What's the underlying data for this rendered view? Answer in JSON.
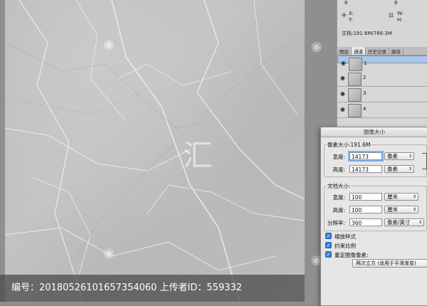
{
  "info_panel": {
    "row1_left": "8",
    "row1_right": "8",
    "x_label": "X:",
    "y_label": "Y:",
    "w_label": "W:",
    "h_label": "H:",
    "doc_size": "文档:191.6M/766.3M"
  },
  "layers_panel": {
    "tabs": [
      "图层",
      "通道",
      "历史记录",
      "路径"
    ],
    "active_tab": "通道",
    "channels": [
      {
        "label": "1",
        "selected": true
      },
      {
        "label": "2",
        "selected": false
      },
      {
        "label": "3",
        "selected": false
      },
      {
        "label": "4",
        "selected": false
      }
    ]
  },
  "dialog": {
    "title": "图像大小",
    "pixel_dims_label": "像素大小:191.6M",
    "width_label": "宽度:",
    "height_label": "高度:",
    "pixel_width": "14173",
    "pixel_height": "14173",
    "pixel_unit": "像素",
    "doc_size_label": "文档大小:",
    "doc_width": "100",
    "doc_height": "100",
    "doc_unit": "厘米",
    "resolution_label": "分辨率:",
    "resolution": "360",
    "resolution_unit": "像素/英寸",
    "scale_styles": "缩放样式",
    "constrain": "约束比例",
    "resample": "重定图像像素:",
    "resample_method": "两次立方 (适用于平滑渐变)"
  },
  "watermark": {
    "text": "编号：20180526101657354060 上传者ID：559332"
  }
}
